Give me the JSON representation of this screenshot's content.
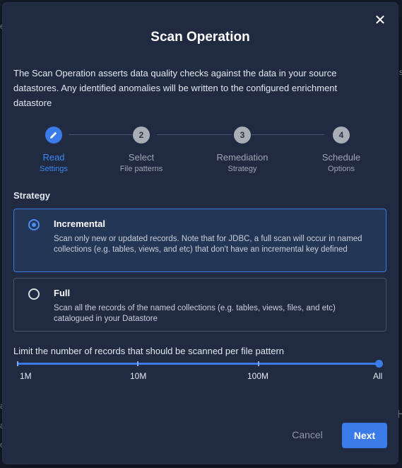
{
  "background": {
    "fragments": [
      "e",
      "s",
      "a",
      "a",
      "o",
      "H"
    ]
  },
  "modal": {
    "title": "Scan Operation",
    "close_icon": "close-icon",
    "description": "The Scan Operation asserts data quality checks against the data in your source datastores. Any identified anomalies will be written to the configured enrichment datastore"
  },
  "stepper": {
    "steps": [
      {
        "number": "",
        "icon": "pencil-icon",
        "label": "Read",
        "sublabel": "Settings",
        "active": true
      },
      {
        "number": "2",
        "label": "Select",
        "sublabel": "File patterns",
        "active": false
      },
      {
        "number": "3",
        "label": "Remediation",
        "sublabel": "Strategy",
        "active": false
      },
      {
        "number": "4",
        "label": "Schedule",
        "sublabel": "Options",
        "active": false
      }
    ]
  },
  "strategy": {
    "label": "Strategy",
    "options": [
      {
        "title": "Incremental",
        "description": "Scan only new or updated records. Note that for JDBC, a full scan will occur in named collections (e.g. tables, views, and etc) that don't have an incremental key defined",
        "selected": true
      },
      {
        "title": "Full",
        "description": "Scan all the records of the named collections (e.g. tables, views, files, and etc) catalogued in your Datastore",
        "selected": false
      }
    ]
  },
  "limit": {
    "label": "Limit the number of records that should be scanned per file pattern",
    "marks": [
      "1M",
      "10M",
      "100M",
      "All"
    ],
    "selected_value": "All"
  },
  "footer": {
    "cancel_label": "Cancel",
    "next_label": "Next"
  },
  "colors": {
    "accent": "#3a7be8",
    "modal_bg": "#202b42",
    "selected_option_bg": "#243656"
  }
}
